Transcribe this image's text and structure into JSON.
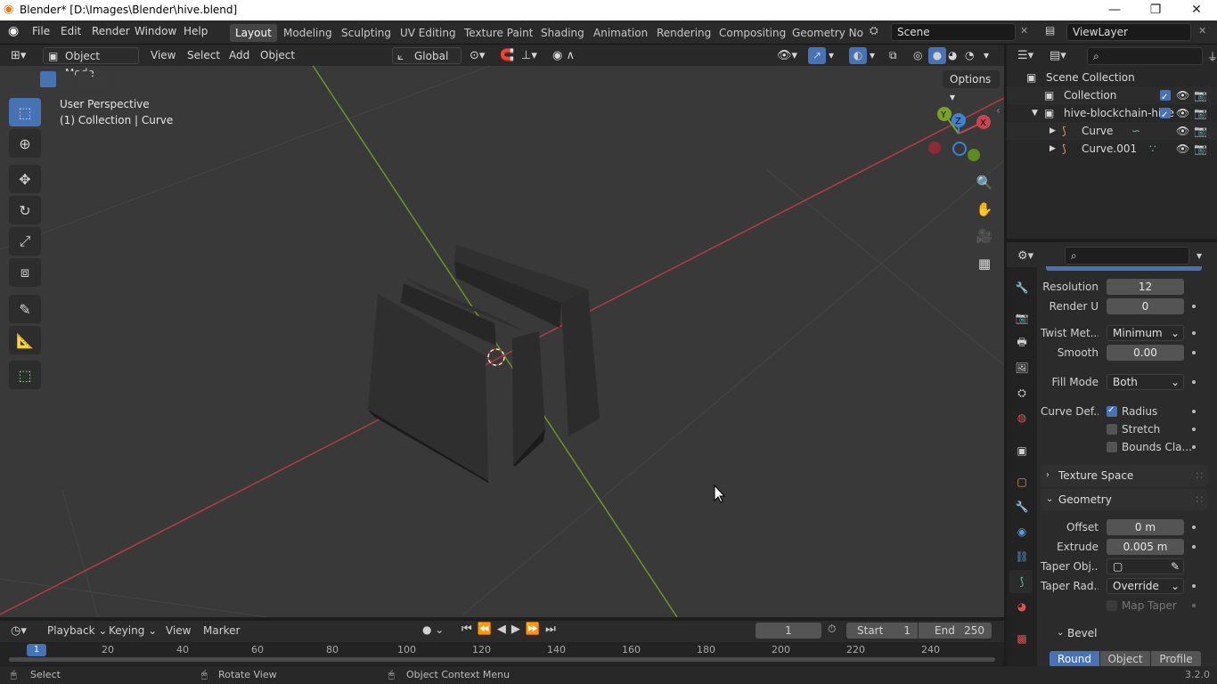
{
  "window": {
    "title": "Blender* [D:\\Images\\Blender\\hive.blend]",
    "minimize": "—",
    "maximize": "❐",
    "close": "✕"
  },
  "menu": [
    "File",
    "Edit",
    "Render",
    "Window",
    "Help"
  ],
  "workspaces": [
    "Layout",
    "Modeling",
    "Sculpting",
    "UV Editing",
    "Texture Paint",
    "Shading",
    "Animation",
    "Rendering",
    "Compositing",
    "Geometry Noc"
  ],
  "scene": "Scene",
  "view_layer": "ViewLayer",
  "viewport_header": {
    "mode": "Object Mode",
    "menus": [
      "View",
      "Select",
      "Add",
      "Object"
    ],
    "orientation": "Global",
    "options": "Options"
  },
  "viewport": {
    "perspective": "User Perspective",
    "collection_info": "(1) Collection | Curve",
    "gizmo_axes": {
      "x": "X",
      "y": "Y",
      "z": "Z"
    }
  },
  "outliner": {
    "rows": [
      {
        "label": "Scene Collection"
      },
      {
        "label": "Collection"
      },
      {
        "label": "hive-blockchain-hive"
      },
      {
        "label": "Curve"
      },
      {
        "label": "Curve.001"
      }
    ]
  },
  "properties": {
    "resolution": {
      "label": "Resolution",
      "value": "12"
    },
    "render_u": {
      "label": "Render U",
      "value": "0"
    },
    "twist_method": {
      "label": "Twist Met...",
      "value": "Minimum"
    },
    "smooth": {
      "label": "Smooth",
      "value": "0.00"
    },
    "fill_mode": {
      "label": "Fill Mode",
      "value": "Both"
    },
    "curve_deform": {
      "label": "Curve Def...",
      "radius": "Radius",
      "stretch": "Stretch",
      "bounds": "Bounds Cla..."
    },
    "texture_space": "Texture Space",
    "geometry": "Geometry",
    "offset": {
      "label": "Offset",
      "value": "0 m"
    },
    "extrude": {
      "label": "Extrude",
      "value": "0.005 m"
    },
    "taper_object": {
      "label": "Taper Obj..."
    },
    "taper_radius": {
      "label": "Taper Rad...",
      "value": "Override"
    },
    "map_taper": "Map Taper",
    "bevel": "Bevel",
    "bevel_modes": [
      "Round",
      "Object",
      "Profile"
    ]
  },
  "timeline": {
    "menus": [
      "Playback",
      "Keying",
      "View",
      "Marker"
    ],
    "current_frame": "1",
    "start_label": "Start",
    "start": "1",
    "end_label": "End",
    "end": "250",
    "ticks": [
      "1",
      "20",
      "40",
      "60",
      "80",
      "100",
      "120",
      "140",
      "160",
      "180",
      "200",
      "220",
      "240"
    ]
  },
  "statusbar": {
    "select": "Select",
    "rotate": "Rotate View",
    "context": "Object Context Menu",
    "version": "3.2.0"
  },
  "colors": {
    "accent": "#4772b3",
    "x_axis": "#c94450",
    "y_axis": "#7aa22a",
    "z_axis": "#3d82d6"
  }
}
